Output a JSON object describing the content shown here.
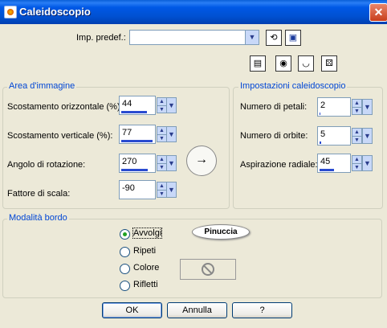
{
  "window": {
    "title": "Caleidoscopio",
    "close_glyph": "✕"
  },
  "presets": {
    "label": "Imp. predef.:",
    "value": "",
    "load_icon": "refresh-icon",
    "save_icon": "floppy-icon",
    "preview_icons": [
      "reset-icon",
      "eye-open-icon",
      "eye-closed-icon",
      "dice-icon"
    ]
  },
  "image_area": {
    "legend": "Area d'immagine",
    "fields": [
      {
        "label": "Scostamento orizzontale (%):",
        "value": "44",
        "fill": 0.72
      },
      {
        "label": "Scostamento verticale (%):",
        "value": "77",
        "fill": 0.88
      },
      {
        "label": "Angolo di rotazione:",
        "value": "270",
        "fill": 0.75
      },
      {
        "label": "Fattore di scala:",
        "value": "-90",
        "fill": 0.0
      }
    ],
    "rotation_glyph": "→"
  },
  "kaleidoscope": {
    "legend": "Impostazioni caleidoscopio",
    "fields": [
      {
        "label": "Numero di petali:",
        "value": "2",
        "fill": 0.03
      },
      {
        "label": "Numero di orbite:",
        "value": "5",
        "fill": 0.06
      },
      {
        "label": "Aspirazione radiale:",
        "value": "45",
        "fill": 0.45
      }
    ]
  },
  "edge_mode": {
    "legend": "Modalità bordo",
    "options": [
      "Avvolgi",
      "Ripeti",
      "Colore",
      "Rifletti"
    ],
    "selected": "Avvolgi",
    "logo_text": "Pinuccia"
  },
  "buttons": {
    "ok": "OK",
    "cancel": "Annulla",
    "help": "?"
  },
  "colors": {
    "accent": "#0046d5",
    "title_bar": "#0058e6",
    "spin_fill": "#2a4bd0"
  }
}
